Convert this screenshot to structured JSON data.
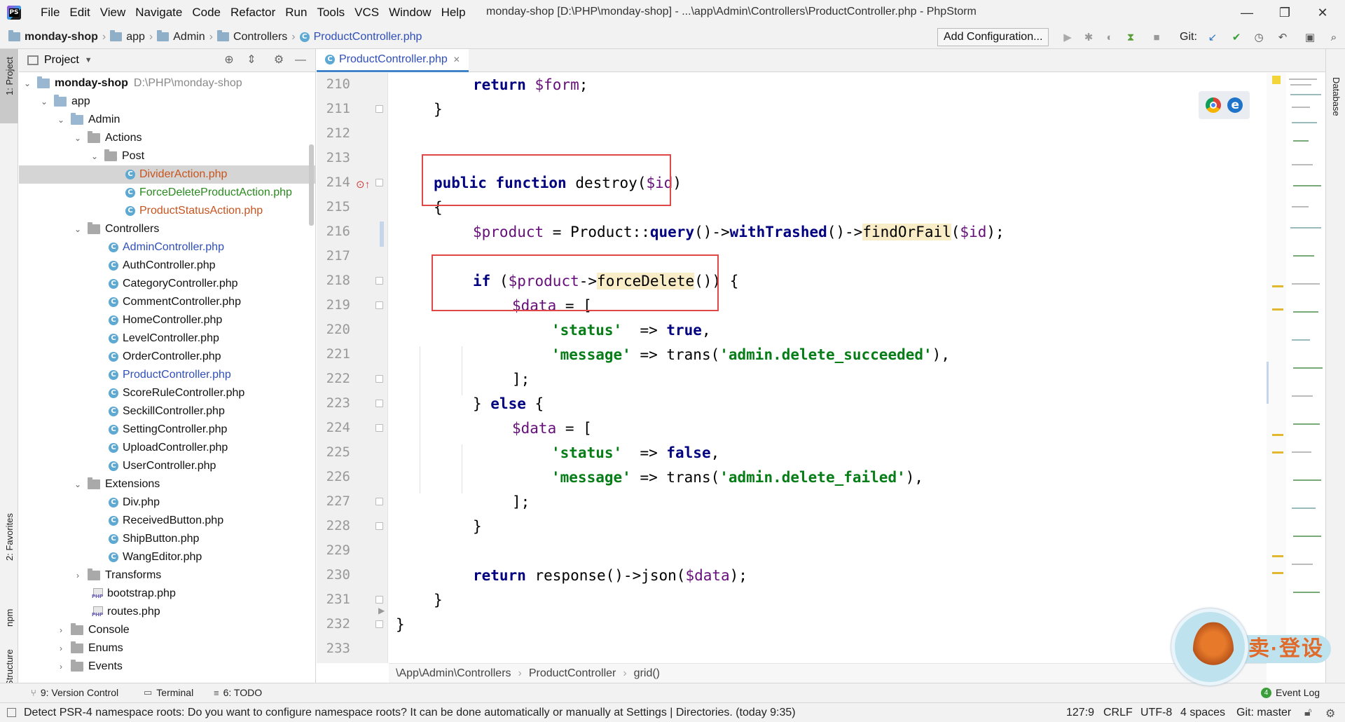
{
  "window": {
    "title": "monday-shop [D:\\PHP\\monday-shop] - ...\\app\\Admin\\Controllers\\ProductController.php - PhpStorm",
    "logo_text": "PS",
    "minimize": "—",
    "maximize": "❐",
    "close": "✕"
  },
  "menu": [
    "File",
    "Edit",
    "View",
    "Navigate",
    "Code",
    "Refactor",
    "Run",
    "Tools",
    "VCS",
    "Window",
    "Help"
  ],
  "breadcrumb": {
    "items": [
      "monday-shop",
      "app",
      "Admin",
      "Controllers"
    ],
    "file": "ProductController.php",
    "file_icon": "C"
  },
  "toolbar": {
    "add_config": "Add Configuration...",
    "git_label": "Git:",
    "icons": [
      "run-icon",
      "debug-icon",
      "coverage-icon",
      "profile-icon",
      "stop-icon",
      "vcs-update-icon",
      "vcs-commit-icon",
      "history-icon",
      "rollback-icon",
      "layout-icon",
      "search-icon"
    ]
  },
  "left_strip": {
    "project": "1: Project",
    "favorites": "2: Favorites",
    "npm": "npm",
    "structure": "Z: Structure"
  },
  "project": {
    "header": "Project",
    "tree": [
      {
        "label": "monday-shop",
        "hint": "D:\\PHP\\monday-shop"
      },
      {
        "label": "app"
      },
      {
        "label": "Admin"
      },
      {
        "label": "Actions"
      },
      {
        "label": "Post"
      },
      {
        "label": "DividerAction.php"
      },
      {
        "label": "ForceDeleteProductAction.php"
      },
      {
        "label": "ProductStatusAction.php"
      },
      {
        "label": "Controllers"
      },
      {
        "label": "AdminController.php"
      },
      {
        "label": "AuthController.php"
      },
      {
        "label": "CategoryController.php"
      },
      {
        "label": "CommentController.php"
      },
      {
        "label": "HomeController.php"
      },
      {
        "label": "LevelController.php"
      },
      {
        "label": "OrderController.php"
      },
      {
        "label": "ProductController.php"
      },
      {
        "label": "ScoreRuleController.php"
      },
      {
        "label": "SeckillController.php"
      },
      {
        "label": "SettingController.php"
      },
      {
        "label": "UploadController.php"
      },
      {
        "label": "UserController.php"
      },
      {
        "label": "Extensions"
      },
      {
        "label": "Div.php"
      },
      {
        "label": "ReceivedButton.php"
      },
      {
        "label": "ShipButton.php"
      },
      {
        "label": "WangEditor.php"
      },
      {
        "label": "Transforms"
      },
      {
        "label": "bootstrap.php"
      },
      {
        "label": "routes.php"
      },
      {
        "label": "Console"
      },
      {
        "label": "Enums"
      },
      {
        "label": "Events"
      }
    ]
  },
  "editor": {
    "tab": "ProductController.php",
    "line_numbers": [
      "210",
      "211",
      "212",
      "213",
      "214",
      "215",
      "216",
      "217",
      "218",
      "219",
      "220",
      "221",
      "222",
      "223",
      "224",
      "225",
      "226",
      "227",
      "228",
      "229",
      "230",
      "231",
      "232",
      "233"
    ],
    "code": {
      "l210": {
        "kw": "return",
        "var": "$form",
        "end": ";"
      },
      "l211": "}",
      "l214": {
        "kw1": "public",
        "kw2": "function",
        "name": " destroy(",
        "var": "$id",
        "end": ")"
      },
      "l215": "{",
      "l216": {
        "var": "$product",
        "a": " = Product::",
        "f1": "query",
        "b": "()->",
        "f2": "withTrashed",
        "c": "()->",
        "f3": "findOrFail",
        "d": "(",
        "var2": "$id",
        "e": ");"
      },
      "l218": {
        "kw": "if",
        "a": " (",
        "var": "$product",
        "b": "->",
        "f": "forceDelete",
        "c": "()) {"
      },
      "l219": {
        "var": "$data",
        "a": " = ["
      },
      "l220": {
        "str": "'status'",
        "a": "  => ",
        "kw": "true",
        "b": ","
      },
      "l221": {
        "str": "'message'",
        "a": " => trans(",
        "str2": "'admin.delete_succeeded'",
        "b": "),"
      },
      "l222": "];",
      "l223": {
        "a": "} ",
        "kw": "else",
        "b": " {"
      },
      "l224": {
        "var": "$data",
        "a": " = ["
      },
      "l225": {
        "str": "'status'",
        "a": "  => ",
        "kw": "false",
        "b": ","
      },
      "l226": {
        "str": "'message'",
        "a": " => trans(",
        "str2": "'admin.delete_failed'",
        "b": "),"
      },
      "l227": "];",
      "l228": "}",
      "l230": {
        "kw": "return",
        "a": " response()->json(",
        "var": "$data",
        "b": ");"
      },
      "l231": "}",
      "l232": "}"
    },
    "bottom_crumbs": [
      "\\App\\Admin\\Controllers",
      "ProductController",
      "grid()"
    ]
  },
  "right_strip": {
    "database": "Database"
  },
  "toolwindows": {
    "version_control": "9: Version Control",
    "terminal": "Terminal",
    "todo": "6: TODO",
    "event_log": "Event Log",
    "event_count": "4"
  },
  "status": {
    "message": "Detect PSR-4 namespace roots: Do you want to configure namespace roots? It can be done automatically or manually at Settings | Directories. (today 9:35)",
    "position": "127:9",
    "line_sep": "CRLF",
    "encoding": "UTF-8",
    "indent": "4 spaces",
    "git": "Git: master"
  },
  "colors": {
    "keyword": "#000080",
    "variable": "#660e7a",
    "string": "#067d17",
    "highlight": "#f8edc6",
    "annotation_box": "#e04848",
    "selection": "#d5d5d5"
  }
}
